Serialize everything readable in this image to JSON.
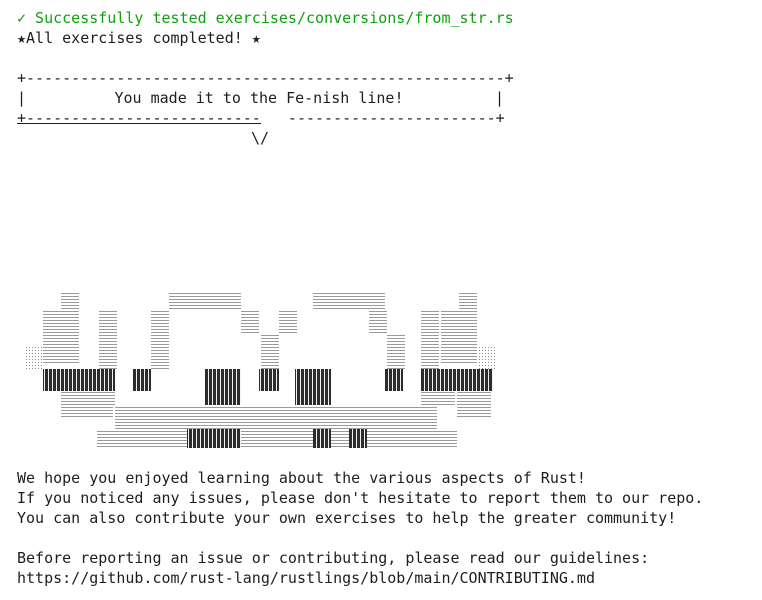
{
  "status": {
    "check_icon": "check-mark",
    "success_text": "✓ Successfully tested exercises/conversions/from_str.rs",
    "completed_text": "★All exercises completed! ★",
    "accent_color": "#0ea20e"
  },
  "banner": {
    "top_border": "+-----------------------------------------------------+",
    "title": "You made it to the Fe-nish line!",
    "left_edge": "|",
    "right_edge": "|",
    "bottom_border": "+--------------------------   -----------------------+",
    "tail": "\\/"
  },
  "crab": {
    "icon": "ferris-crab-ascii-art"
  },
  "messages": {
    "line1": "We hope you enjoyed learning about the various aspects of Rust!",
    "line2": "If you noticed any issues, please don't hesitate to report them to our repo.",
    "line3": "You can also contribute your own exercises to help the greater community!",
    "line4": "",
    "line5": "Before reporting an issue or contributing, please read our guidelines:",
    "line6": "https://github.com/rust-lang/rustlings/blob/main/CONTRIBUTING.md"
  }
}
